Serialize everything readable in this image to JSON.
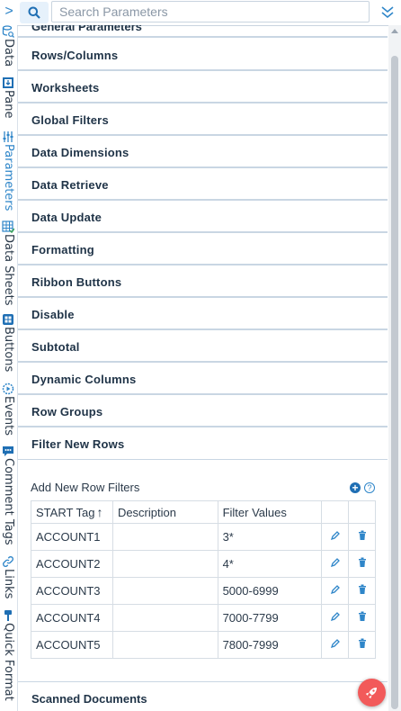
{
  "rail": {
    "expand_label": ">",
    "items": [
      {
        "label": "Data",
        "icon": "data-icon"
      },
      {
        "label": "Pane",
        "icon": "pane-icon"
      },
      {
        "label": "Parameters",
        "icon": "parameters-icon"
      },
      {
        "label": "Data Sheets",
        "icon": "data-sheets-icon"
      },
      {
        "label": "Buttons",
        "icon": "buttons-icon"
      },
      {
        "label": "Events",
        "icon": "events-icon"
      },
      {
        "label": "Comment Tags",
        "icon": "comment-tags-icon"
      },
      {
        "label": "Links",
        "icon": "links-icon"
      },
      {
        "label": "Quick Format",
        "icon": "quick-format-icon"
      }
    ],
    "active_item": "Parameters"
  },
  "search": {
    "placeholder": "Search Parameters",
    "value": ""
  },
  "sections": {
    "cut_off": "General Parameters",
    "items": [
      "Rows/Columns",
      "Worksheets",
      "Global Filters",
      "Data Dimensions",
      "Data Retrieve",
      "Data Update",
      "Formatting",
      "Ribbon Buttons",
      "Disable",
      "Subtotal",
      "Dynamic Columns",
      "Row Groups",
      "Filter New Rows"
    ],
    "after": "Scanned Documents"
  },
  "filter_panel": {
    "title": "Add New Row Filters",
    "headers": [
      "START Tag",
      "Description",
      "Filter Values"
    ],
    "sort_indicator": "↑",
    "rows": [
      {
        "tag": "ACCOUNT1",
        "description": "",
        "filter": "3*"
      },
      {
        "tag": "ACCOUNT2",
        "description": "",
        "filter": "4*"
      },
      {
        "tag": "ACCOUNT3",
        "description": "",
        "filter": "5000-6999"
      },
      {
        "tag": "ACCOUNT4",
        "description": "",
        "filter": "7000-7799"
      },
      {
        "tag": "ACCOUNT5",
        "description": "",
        "filter": "7800-7999"
      }
    ]
  },
  "colors": {
    "accent": "#2f86c9",
    "fab": "#f25a5a",
    "section_border": "#c9d6e3"
  }
}
